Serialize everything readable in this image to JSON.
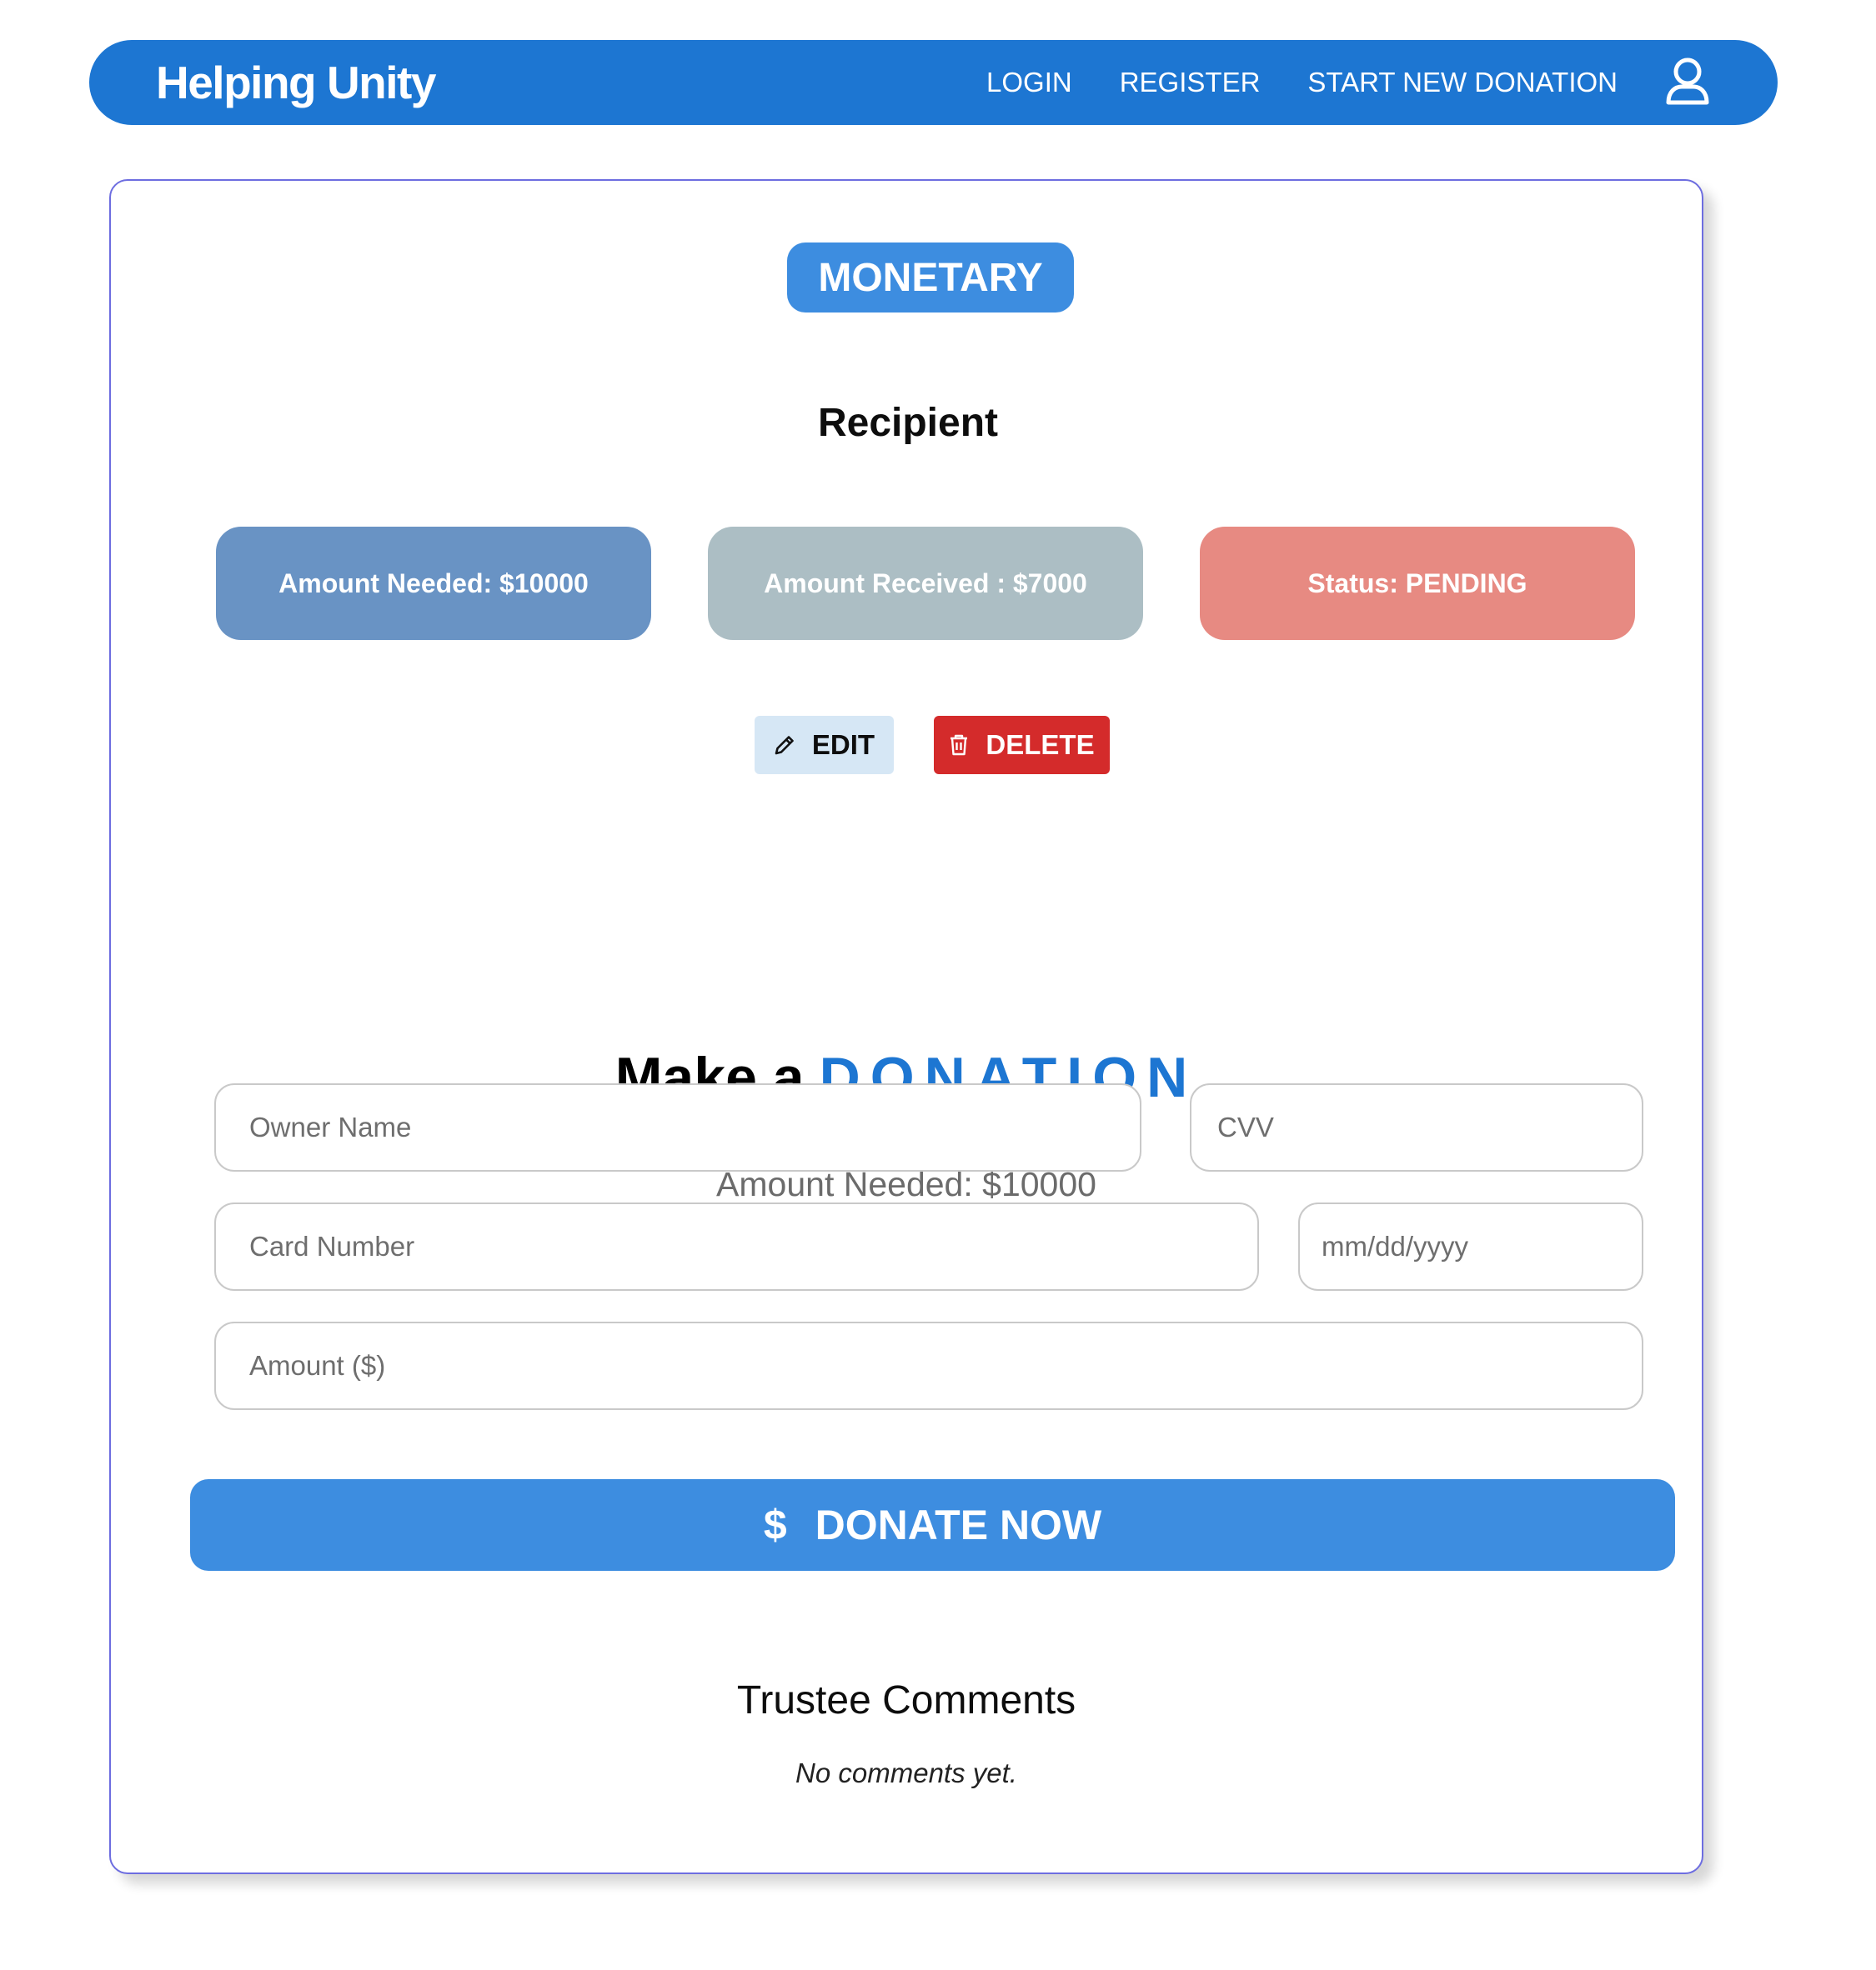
{
  "navbar": {
    "brand": "Helping Unity",
    "links": [
      "LOGIN",
      "REGISTER",
      "START NEW DONATION"
    ],
    "user_icon": "user-icon"
  },
  "donation": {
    "category_badge": "MONETARY",
    "recipient_heading": "Recipient",
    "stats": {
      "amount_needed": "Amount Needed: $10000",
      "amount_received": "Amount Received : $7000",
      "status": "Status: PENDING"
    },
    "actions": {
      "edit_label": "EDIT",
      "delete_label": "DELETE"
    }
  },
  "donate_form": {
    "heading_prefix": "Make a",
    "heading_accent": "DONATION",
    "amount_needed_line": "Amount Needed: $10000",
    "placeholders": {
      "owner_name": "Owner Name",
      "cvv": "CVV",
      "card_number": "Card Number",
      "expiry": "mm/dd/yyyy",
      "amount": "Amount ($)"
    },
    "submit_icon": "$",
    "submit_label": "DONATE NOW"
  },
  "comments": {
    "heading": "Trustee Comments",
    "empty_text": "No comments yet."
  },
  "colors": {
    "primary": "#1d76d2",
    "badge_blue": "#3d8de0",
    "needed_bg": "#6993c4",
    "received_bg": "#acbec4",
    "status_bg": "#e78a82",
    "delete_red": "#d42b2b",
    "edit_bg": "#d6e7f5"
  }
}
